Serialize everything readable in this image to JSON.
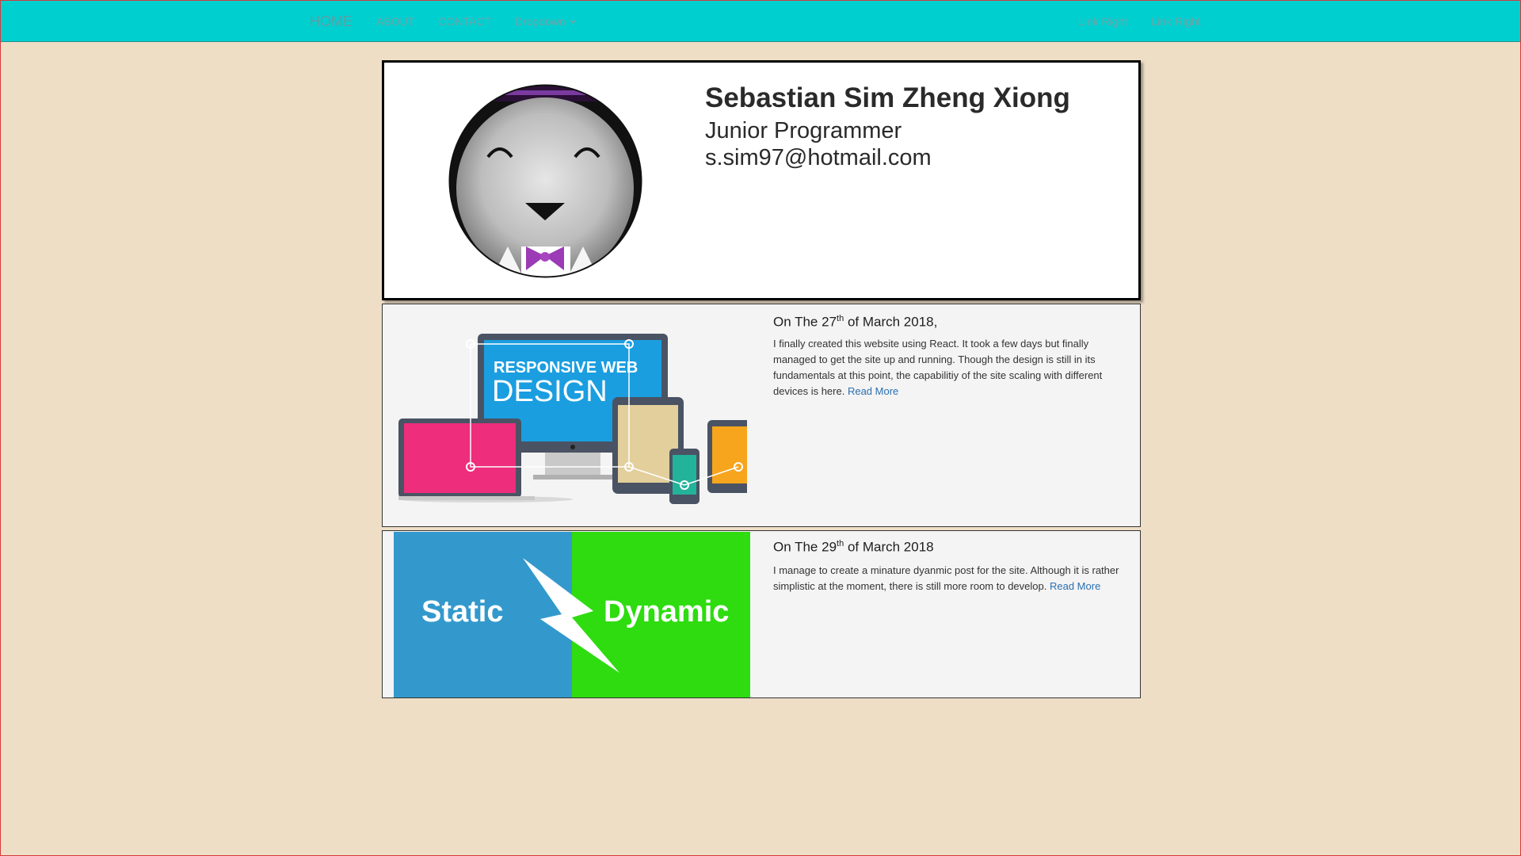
{
  "nav": {
    "home": "HOME",
    "about": "ABOUT",
    "contact": "CONTACT",
    "dropdown": "Dropdown",
    "link_right_1": "Link Right",
    "link_right_2": "Link Right"
  },
  "profile": {
    "name": "Sebastian Sim Zheng Xiong",
    "role": "Junior Programmer",
    "email": "s.sim97@hotmail.com"
  },
  "posts": [
    {
      "title_prefix": "On The 27",
      "title_sup": "th",
      "title_suffix": " of March 2018,",
      "body": "I finally created this website using React. It took a few days but finally managed to get the site up and running. Though the design is still in its fundamentals at this point, the capabilitiy of the site scaling with different devices is here.",
      "read_more": "Read More",
      "image_text_1": "RESPONSIVE WEB",
      "image_text_2": "DESIGN"
    },
    {
      "title_prefix": "On The 29",
      "title_sup": "th",
      "title_suffix": " of March 2018",
      "body": "I manage to create a minature dyanmic post for the site. Although it is rather simplistic at the moment, there is still more room to develop.",
      "read_more": "Read More",
      "image_text_left": "Static",
      "image_text_right": "Dynamic"
    }
  ],
  "colors": {
    "navbar": "#00cfd0",
    "page_bg": "#eedec6",
    "static_blue": "#3399cc",
    "dynamic_green": "#2edc10",
    "link": "#2a6fb0"
  }
}
